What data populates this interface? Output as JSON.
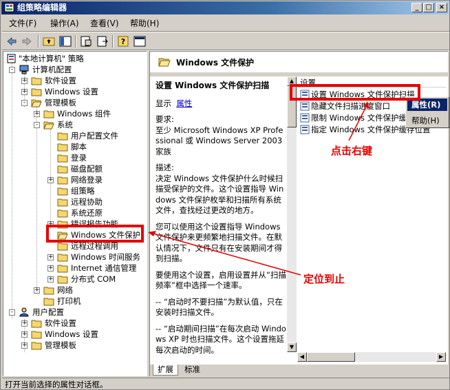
{
  "window": {
    "title": "组策略编辑器"
  },
  "titlebar_buttons": [
    "_",
    "□",
    "×"
  ],
  "menu": [
    "文件(F)",
    "操作(A)",
    "查看(V)",
    "帮助(H)"
  ],
  "tree": {
    "root": "\"本地计算机\" 策略",
    "computer_config": "计算机配置",
    "software_settings": "软件设置",
    "windows_settings": "Windows 设置",
    "admin_templates": "管理模板",
    "windows_components": "Windows 组件",
    "system": "系统",
    "user_profiles": "用户配置文件",
    "scripts": "脚本",
    "logon": "登录",
    "disk_quota": "磁盘配额",
    "net_logon": "网络登录",
    "group_policy": "组策略",
    "remote_assist": "远程协助",
    "system_restore": "系统还原",
    "error_reporting": "错误报告功能",
    "wfp": "Windows 文件保护",
    "rpc": "远程过程调用",
    "time_service": "Windows 时间服务",
    "internet_comm": "Internet 通信管理",
    "dcom": "分布式 COM",
    "network": "网络",
    "printers": "打印机",
    "user_config": "用户配置",
    "u_software_settings": "软件设置",
    "u_windows_settings": "Windows 设置",
    "u_admin_templates": "管理模板"
  },
  "right": {
    "header_title": "Windows 文件保护",
    "desc_title": "设置 Windows 文件保护扫描",
    "display_label": "显示",
    "properties_link": "属性",
    "requirements": "要求:",
    "requirements_text": "至少 Microsoft Windows XP Professional 或 Windows Server 2003 家族",
    "description_label": "描述:",
    "description_text": "决定 Windows 文件保护什么时候扫描受保护的文件。这个设置指导 Windows 文件保护枚举和扫描所有系统文件，查找经过更改的地方。",
    "para2": "您可以使用这个设置指导 Windows 文件保护来更频繁地扫描文件。在默认情况下，文件只有在安装期间才得到扫描。",
    "para3": "要使用这个设置，启用设置并从“扫描频率”框中选择一个速率。",
    "para4": "-- “启动时不要扫描”为默认值，只在安装时扫描文件。",
    "para5": "-- “启动期间扫描”在每次启动 Windows XP 时也扫描文件。这个设置拖延每次启动的时间。",
    "list_header": "设置",
    "list_items": [
      "设置 Windows 文件保护扫描",
      "隐藏文件扫描进度窗口",
      "限制 Windows 文件保护缓存大小",
      "指定 Windows 文件保护缓存位置"
    ],
    "tabs": [
      "扩展",
      "标准"
    ]
  },
  "context_menu": [
    "属性(R)",
    "帮助(H)"
  ],
  "annotations": {
    "right_click": "点击右键",
    "locate": "定位到止"
  },
  "status": "打开当前选择的属性对话框。",
  "colors": {
    "annotation_red": "#e60000",
    "title_blue": "#0a246a",
    "selection": "#0a246a"
  }
}
